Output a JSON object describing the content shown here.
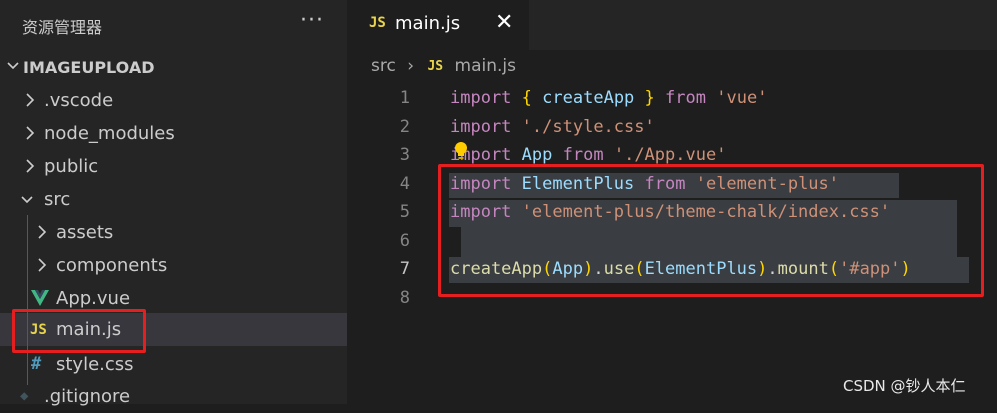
{
  "sidebar": {
    "title": "资源管理器",
    "more_label": "···",
    "root": "IMAGEUPLOAD",
    "items": [
      {
        "label": ".vscode"
      },
      {
        "label": "node_modules"
      },
      {
        "label": "public"
      },
      {
        "label": "src"
      },
      {
        "label": "assets"
      },
      {
        "label": "components"
      },
      {
        "label": "App.vue"
      },
      {
        "label": "main.js"
      },
      {
        "label": "style.css"
      },
      {
        "label": ".gitignore"
      }
    ],
    "icons": {
      "vue": "V",
      "js": "JS",
      "css": "#",
      "git": "◆"
    }
  },
  "tab": {
    "icon": "JS",
    "label": "main.js",
    "close": "✕"
  },
  "breadcrumb": {
    "folder": "src",
    "sep": "›",
    "icon": "JS",
    "file": "main.js"
  },
  "editor": {
    "line_numbers": [
      "1",
      "2",
      "3",
      "4",
      "5",
      "6",
      "7",
      "8"
    ],
    "lines": {
      "l1": {
        "kw": "import",
        "b1": "{",
        "fn": "createApp",
        "b2": "}",
        "kw2": "from",
        "str": "'vue'"
      },
      "l2": {
        "kw": "import",
        "str": "'./style.css'"
      },
      "l3": {
        "kw": "import",
        "var": "App",
        "kw2": "from",
        "str": "'./App.vue'"
      },
      "l4": {
        "kw": "import",
        "var": "ElementPlus",
        "kw2": "from",
        "str": "'element-plus'"
      },
      "l5": {
        "kw": "import",
        "str": "'element-plus/theme-chalk/index.css'"
      },
      "l7": {
        "fn": "createApp",
        "p1": "(",
        "arg1": "App",
        "p2": ")",
        "dot1": ".",
        "fn2": "use",
        "p3": "(",
        "arg2": "ElementPlus",
        "p4": ")",
        "dot2": ".",
        "fn3": "mount",
        "p5": "(",
        "str": "'#app'",
        "p6": ")"
      }
    }
  },
  "watermark": "CSDN @钞人本仁",
  "colors": {
    "accent_red": "#e51f1f",
    "js_yellow": "#e9d44c",
    "vue_green": "#41b883",
    "css_blue": "#519aba"
  }
}
